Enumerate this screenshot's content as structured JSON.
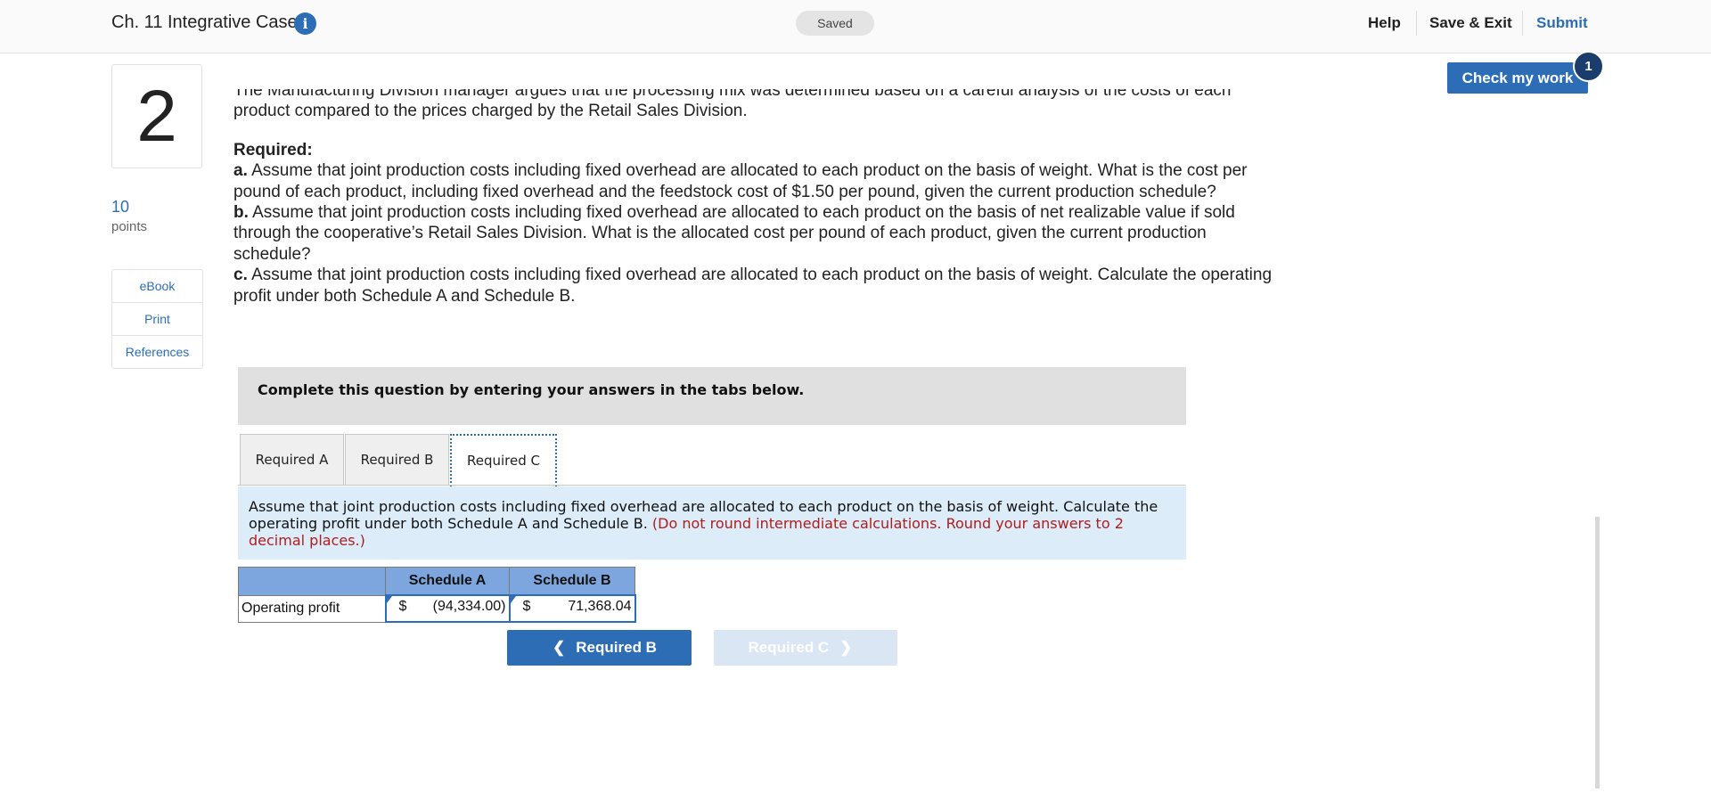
{
  "header": {
    "title": "Ch. 11 Integrative Case",
    "info_icon": "i",
    "status": "Saved",
    "help": "Help",
    "save_exit": "Save & Exit",
    "submit": "Submit"
  },
  "question": {
    "number": "2",
    "points_value": "10",
    "points_label": "points"
  },
  "sidebar": {
    "items": [
      {
        "label": "eBook"
      },
      {
        "label": "Print"
      },
      {
        "label": "References"
      }
    ]
  },
  "check_work": {
    "label": "Check my work",
    "badge": "1"
  },
  "content": {
    "intro": "The Manufacturing Division manager argues that the processing mix was determined based on a careful analysis of the costs of each product compared to the prices charged by the Retail Sales Division.",
    "required_heading": "Required:",
    "items": [
      {
        "letter": "a.",
        "text": "Assume that joint production costs including fixed overhead are allocated to each product on the basis of weight. What is the cost per pound of each product, including fixed overhead and the feedstock cost of $1.50 per pound, given the current production schedule?"
      },
      {
        "letter": "b.",
        "text": "Assume that joint production costs including fixed overhead are allocated to each product on the basis of net realizable value if sold through the cooperative’s Retail Sales Division. What is the allocated cost per pound of each product, given the current production schedule?"
      },
      {
        "letter": "c.",
        "text": "Assume that joint production costs including fixed overhead are allocated to each product on the basis of weight. Calculate the operating profit under both Schedule A and Schedule B."
      }
    ]
  },
  "instructions_box": "Complete this question by entering your answers in the tabs below.",
  "tabs": [
    {
      "label": "Required A"
    },
    {
      "label": "Required B"
    },
    {
      "label": "Required C"
    }
  ],
  "active_tab": "Required C",
  "tab_instruction": {
    "text": "Assume that joint production costs including fixed overhead are allocated to each product on the basis of weight. Calculate the operating profit under both Schedule A and Schedule B.",
    "note": "(Do not round intermediate calculations. Round your answers to 2 decimal places.)"
  },
  "answer_table": {
    "headers": [
      "",
      "Schedule A",
      "Schedule B"
    ],
    "row_label": "Operating profit",
    "currency": "$",
    "schedule_a": "(94,334.00)",
    "schedule_b": "71,368.04"
  },
  "navigation": {
    "prev_label": "Required B",
    "next_label": "Required C"
  },
  "colors": {
    "accent": "#2d6db5",
    "badge": "#1a3d6b",
    "table_header": "#7ea6de",
    "instruction_bg": "#dcecf9",
    "note_red": "#b01d1d"
  }
}
